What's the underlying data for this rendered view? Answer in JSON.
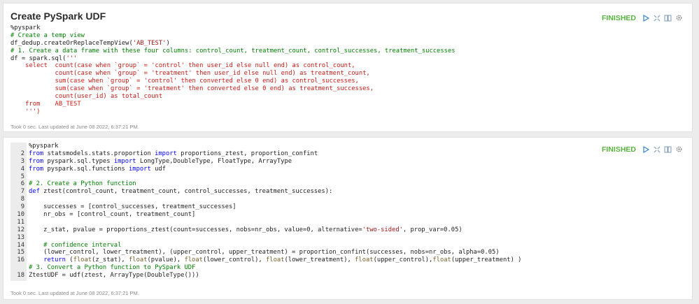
{
  "paragraph1": {
    "title": "Create PySpark UDF",
    "status": "FINISHED",
    "footer": "Took 0 sec. Last updated at June 08 2022, 6:37:21 PM.",
    "lines": [
      [
        {
          "t": "%pyspark",
          "c": ""
        }
      ],
      [
        {
          "t": "# Create a temp view",
          "c": "cm"
        }
      ],
      [
        {
          "t": "df_dedup.createOrReplaceTempView(",
          "c": ""
        },
        {
          "t": "'AB_TEST'",
          "c": "str"
        },
        {
          "t": ")",
          "c": ""
        }
      ],
      [
        {
          "t": "# 1. Create a data frame with these four columns: control_count, treatment_count, control_successes, treatment_successes",
          "c": "cm"
        }
      ],
      [
        {
          "t": "df = spark.sql(",
          "c": ""
        },
        {
          "t": "'''",
          "c": "str"
        }
      ],
      [
        {
          "t": "    select  count(case when `group` = 'control' then user_id else null end) as control_count,",
          "c": "sql"
        }
      ],
      [
        {
          "t": "            count(case when `group` = 'treatment' then user_id else null end) as treatment_count,",
          "c": "sql"
        }
      ],
      [
        {
          "t": "            sum(case when `group` = 'control' then converted else 0 end) as control_successes,",
          "c": "sql"
        }
      ],
      [
        {
          "t": "            sum(case when `group` = 'treatment' then converted else 0 end) as treatment_successes,",
          "c": "sql"
        }
      ],
      [
        {
          "t": "            count(user_id) as total_count",
          "c": "sql"
        }
      ],
      [
        {
          "t": "    from    AB_TEST",
          "c": "sql"
        }
      ],
      [
        {
          "t": "    ''')",
          "c": "sql"
        }
      ]
    ]
  },
  "paragraph2": {
    "status": "FINISHED",
    "footer": "Took 0 sec. Last updated at June 08 2022, 6:37:21 PM.",
    "lines": [
      {
        "n": "",
        "segs": [
          {
            "t": "%pyspark",
            "c": ""
          }
        ]
      },
      {
        "n": "2",
        "segs": [
          {
            "t": "from",
            "c": "kw"
          },
          {
            "t": " statsmodels.stats.proportion ",
            "c": ""
          },
          {
            "t": "import",
            "c": "kw"
          },
          {
            "t": " proportions_ztest, proportion_confint",
            "c": ""
          }
        ]
      },
      {
        "n": "3",
        "segs": [
          {
            "t": "from",
            "c": "kw"
          },
          {
            "t": " pyspark.sql.types ",
            "c": ""
          },
          {
            "t": "import",
            "c": "kw"
          },
          {
            "t": " LongType,DoubleType, FloatType, ArrayType",
            "c": ""
          }
        ]
      },
      {
        "n": "4",
        "segs": [
          {
            "t": "from",
            "c": "kw"
          },
          {
            "t": " pyspark.sql.functions ",
            "c": ""
          },
          {
            "t": "import",
            "c": "kw"
          },
          {
            "t": " udf",
            "c": ""
          }
        ]
      },
      {
        "n": "5",
        "segs": [
          {
            "t": "",
            "c": ""
          }
        ]
      },
      {
        "n": "6",
        "segs": [
          {
            "t": "# 2. Create a Python function",
            "c": "cm"
          }
        ]
      },
      {
        "n": "7",
        "segs": [
          {
            "t": "def",
            "c": "kw"
          },
          {
            "t": " ztest(control_count, treatment_count, control_successes, treatment_successes):",
            "c": ""
          }
        ]
      },
      {
        "n": "8",
        "segs": [
          {
            "t": "",
            "c": ""
          }
        ]
      },
      {
        "n": "9",
        "segs": [
          {
            "t": "    successes = [control_successes, treatment_successes]",
            "c": ""
          }
        ]
      },
      {
        "n": "10",
        "segs": [
          {
            "t": "    nr_obs = [control_count, treatment_count]",
            "c": ""
          }
        ]
      },
      {
        "n": "11",
        "segs": [
          {
            "t": "",
            "c": ""
          }
        ]
      },
      {
        "n": "12",
        "segs": [
          {
            "t": "    z_stat, pvalue = proportions_ztest(count=successes, nobs=nr_obs, value=0, alternative=",
            "c": ""
          },
          {
            "t": "'two-sided'",
            "c": "str"
          },
          {
            "t": ", prop_var=0.05)",
            "c": ""
          }
        ]
      },
      {
        "n": "13",
        "segs": [
          {
            "t": "",
            "c": ""
          }
        ]
      },
      {
        "n": "14",
        "segs": [
          {
            "t": "    # confidence interval",
            "c": "cm"
          }
        ]
      },
      {
        "n": "15",
        "segs": [
          {
            "t": "    (lower_control, lower_treatment), (upper_control, upper_treatment) = proportion_confint(successes, nobs=nr_obs, alpha=0.05)",
            "c": ""
          }
        ]
      },
      {
        "n": "16",
        "segs": [
          {
            "t": "    ",
            "c": ""
          },
          {
            "t": "return",
            "c": "kw"
          },
          {
            "t": " (",
            "c": ""
          },
          {
            "t": "float",
            "c": "fn"
          },
          {
            "t": "(z_stat), ",
            "c": ""
          },
          {
            "t": "float",
            "c": "fn"
          },
          {
            "t": "(pvalue), ",
            "c": ""
          },
          {
            "t": "float",
            "c": "fn"
          },
          {
            "t": "(lower_control), ",
            "c": ""
          },
          {
            "t": "float",
            "c": "fn"
          },
          {
            "t": "(lower_treatment), ",
            "c": ""
          },
          {
            "t": "float",
            "c": "fn"
          },
          {
            "t": "(upper_control),",
            "c": ""
          },
          {
            "t": "float",
            "c": "fn"
          },
          {
            "t": "(upper_treatment) )",
            "c": ""
          }
        ]
      },
      {
        "n": "",
        "segs": [
          {
            "t": "# 3. Convert a Python function to PySpark UDF",
            "c": "cm"
          }
        ]
      },
      {
        "n": "18",
        "segs": [
          {
            "t": "ZtestUDF = udf(ztest, ArrayType(DoubleType()))",
            "c": ""
          }
        ]
      }
    ]
  },
  "icons": [
    "run-icon",
    "expand-icon",
    "book-icon",
    "settings-icon"
  ]
}
